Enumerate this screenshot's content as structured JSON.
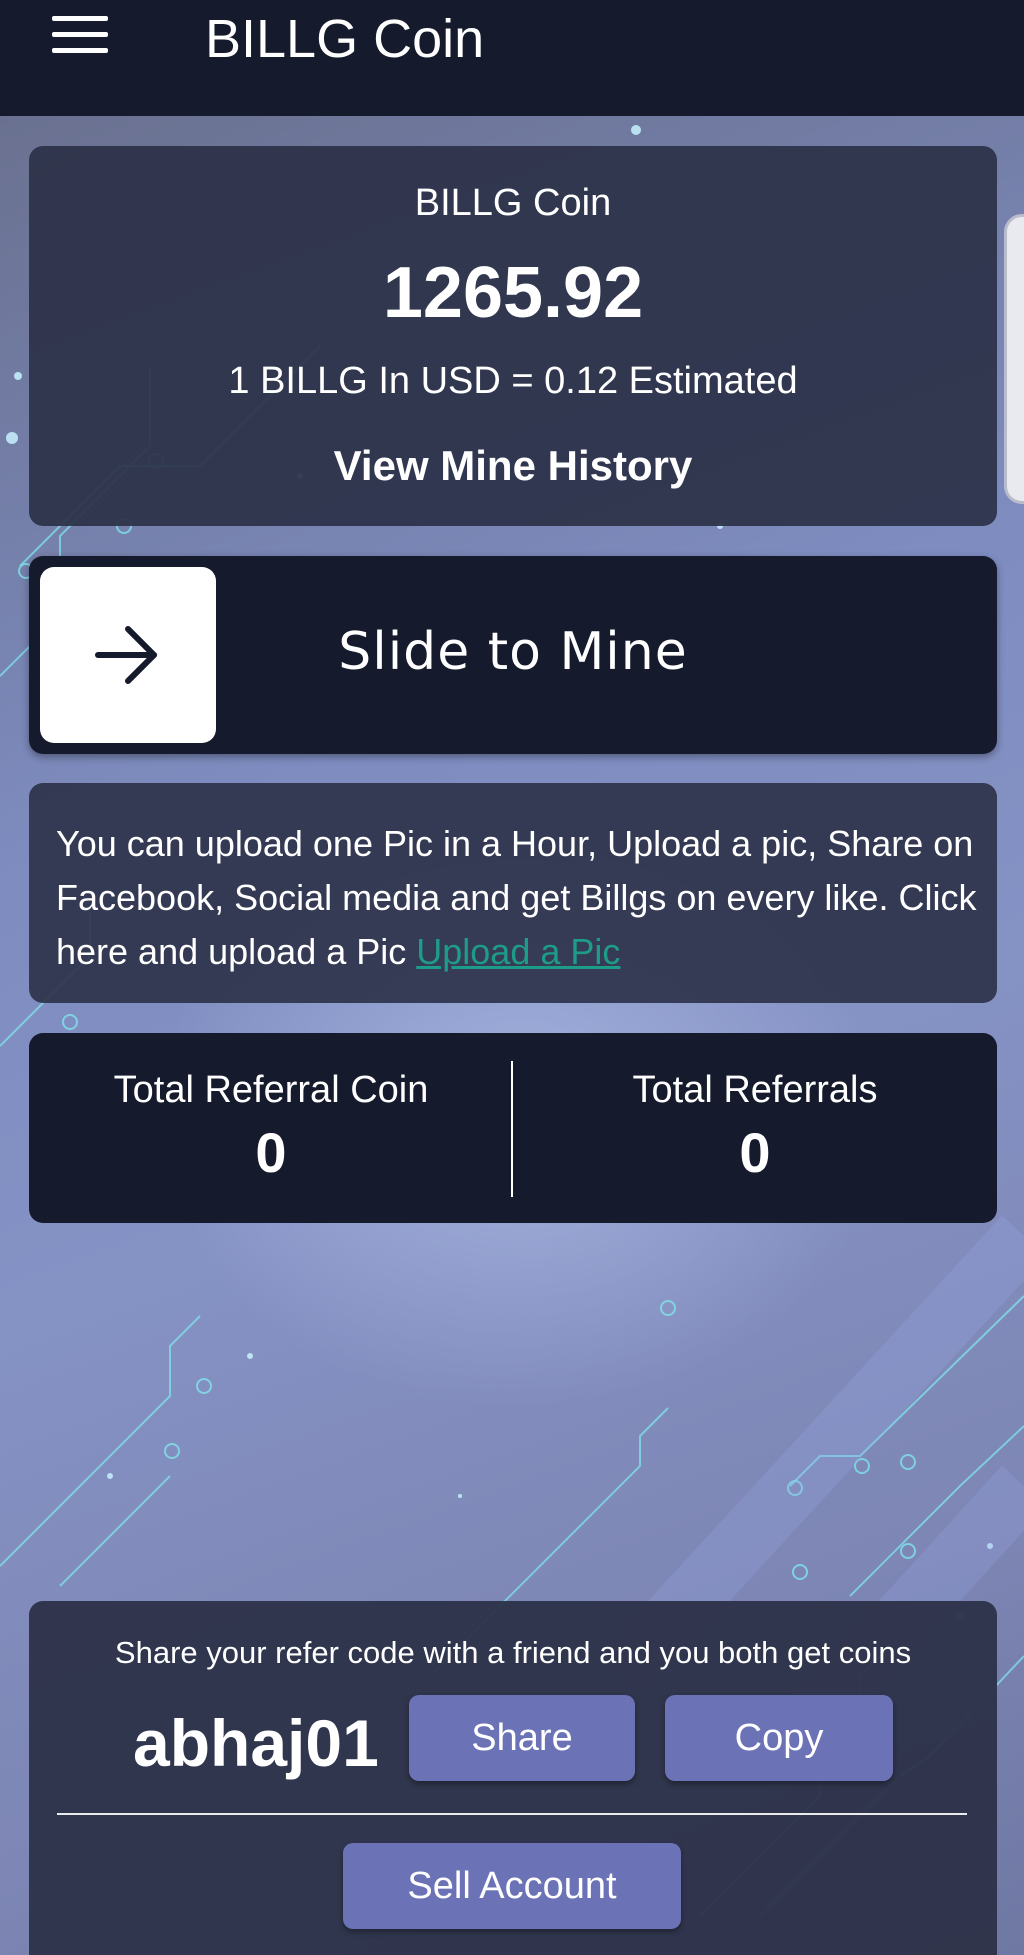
{
  "header": {
    "menu_icon": "hamburger-menu-icon",
    "title": "BILLG Coin"
  },
  "balance": {
    "label": "BILLG Coin",
    "amount": "1265.92",
    "rate_text": "1 BILLG In USD = 0.12 Estimated",
    "history_link": "View Mine History"
  },
  "slider": {
    "icon": "arrow-right-icon",
    "label": "Slide to Mine"
  },
  "upload": {
    "text": "You can upload one Pic in a Hour, Upload a pic, Share on Facebook, Social media and get Billgs on every like. Click here and upload a Pic ",
    "link_label": "Upload a Pic"
  },
  "referrals": {
    "coin_label": "Total Referral Coin",
    "coin_value": "0",
    "count_label": "Total Referrals",
    "count_value": "0"
  },
  "share": {
    "text": "Share your refer code with a friend and you both get coins",
    "code": "abhaj01",
    "share_label": "Share",
    "copy_label": "Copy",
    "sell_label": "Sell Account"
  },
  "colors": {
    "topbar": "#151a2c",
    "card": "#2c3148",
    "button": "#6b73b6",
    "link": "#1d9c88"
  }
}
